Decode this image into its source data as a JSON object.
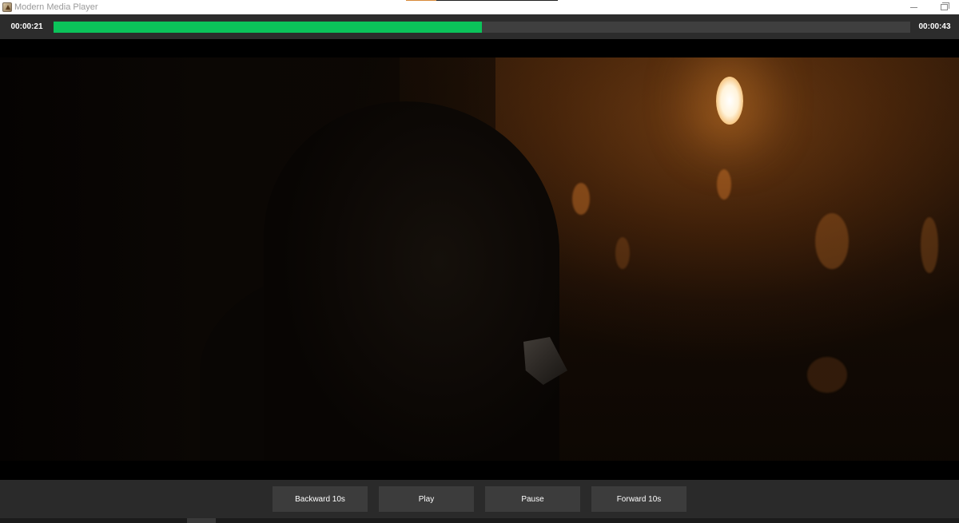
{
  "window": {
    "title": "Modern Media Player",
    "controls": {
      "minimize_icon": "minimize-icon",
      "restore_icon": "restore-icon"
    }
  },
  "player": {
    "current_time": "00:00:21",
    "total_time": "00:00:43",
    "progress_fraction": 0.5,
    "progress_color": "#0bc35a"
  },
  "controls": {
    "backward_label": "Backward 10s",
    "play_label": "Play",
    "pause_label": "Pause",
    "forward_label": "Forward 10s"
  },
  "colors": {
    "topbar": "#2c2c2c",
    "track": "#3f3f3f",
    "button": "#3c3c3c",
    "control_bar": "#2a2a2a"
  }
}
